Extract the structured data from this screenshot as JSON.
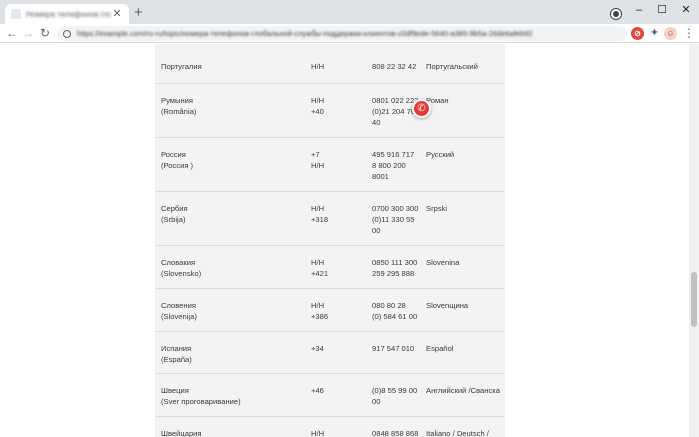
{
  "browser": {
    "tab_title": "Номера телефонов глобальной службы поддержки",
    "tab_close": "✕",
    "new_tab": "+",
    "url": "https://example.com/ru-ru/topic/номера-телефонов-глобальной-службы-поддержки-клиентов-c0df9ede-5640-a385-9b5a-26de6afeb92",
    "window_controls": {
      "minimize": "–",
      "maximize": "☐",
      "close": "✕"
    },
    "nav": {
      "back": "←",
      "forward": "→",
      "reload": "↻"
    },
    "icons": {
      "extension_1": "red-circle-extension-icon",
      "extension_2": "puzzle-extensions-icon",
      "extension_3": "profile-avatar-icon",
      "menu": "three-dot-menu-icon"
    }
  },
  "table": {
    "rows": [
      {
        "country": [
          "Португалия"
        ],
        "hours": [
          "Н/Н"
        ],
        "phone": [
          "808 22 32 42"
        ],
        "language": [
          "Португальский"
        ]
      },
      {
        "country": [
          "Румыния",
          "(România)"
        ],
        "hours": [
          "Н/Н",
          "+40"
        ],
        "phone": [
          "0801 022 222",
          "(0)21 204 70",
          "40"
        ],
        "language": [
          "Роман"
        ]
      },
      {
        "country": [
          "Россия",
          "(Россия )"
        ],
        "hours": [
          "+7",
          "Н/Н"
        ],
        "phone": [
          "495 916 717",
          "8 800 200",
          "8001"
        ],
        "language": [
          "Русский"
        ]
      },
      {
        "country": [
          "Сербия",
          "(Srbija)"
        ],
        "hours": [
          "Н/Н",
          "+318"
        ],
        "phone": [
          "0700 300 300",
          "(0)11 330 55",
          "00"
        ],
        "language": [
          "Srpski"
        ]
      },
      {
        "country": [
          "Словакия",
          "(Slovensko)"
        ],
        "hours": [
          "Н/Н",
          "+421"
        ],
        "phone": [
          "0850 111 300",
          "259 295 888"
        ],
        "language": [
          "Slovenina"
        ]
      },
      {
        "country": [
          "Словения",
          "(Slovenija)"
        ],
        "hours": [
          "Н/Н",
          "+386"
        ],
        "phone": [
          "080 80 28",
          "(0) 584 61 00"
        ],
        "language": [
          "Slovenщина"
        ]
      },
      {
        "country": [
          "Испания",
          "(España)"
        ],
        "hours": [
          "+34"
        ],
        "phone": [
          "917 547 010"
        ],
        "language": [
          "Español"
        ]
      },
      {
        "country": [
          "Швеция",
          "(Sver проговаривание)"
        ],
        "hours": [
          "+46"
        ],
        "phone": [
          "(0)8 55 99 00",
          "00"
        ],
        "language": [
          "Английский /Сванска"
        ]
      },
      {
        "country": [
          "Швейцария"
        ],
        "hours": [
          "Н/Н"
        ],
        "phone": [
          "0848 858 868"
        ],
        "language": [
          "Italiano / Deutsch /"
        ]
      }
    ]
  },
  "call_badge_icon": "phone-call-icon",
  "colors": {
    "panel_bg": "#f3f3f3",
    "row_divider": "#dcdcdc",
    "call_badge": "#e53935",
    "chrome_bg": "#dee1e6"
  }
}
